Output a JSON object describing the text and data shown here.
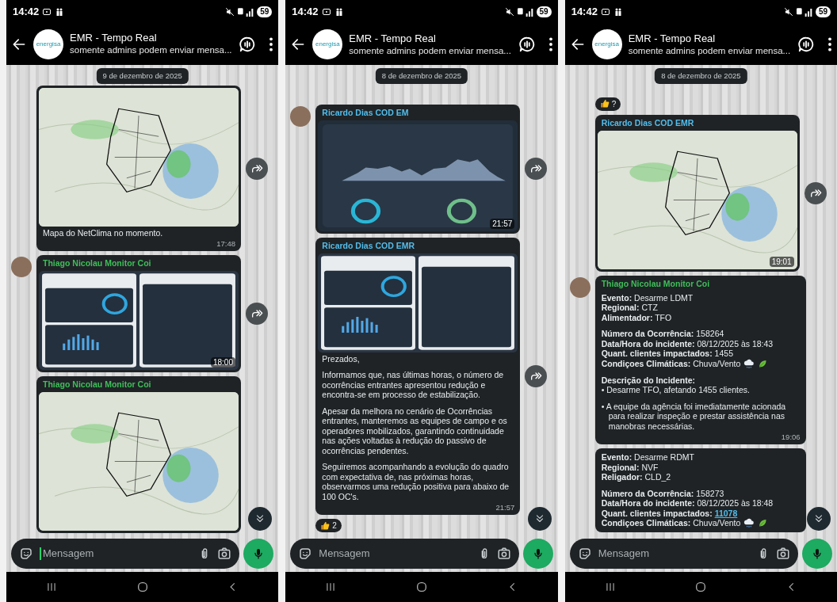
{
  "screens": [
    {
      "status_bar": {
        "time": "14:42",
        "battery": "59"
      },
      "header": {
        "logo_text": "energisa",
        "title": "EMR - Tempo Real",
        "subtitle": "somente admins podem enviar mensa..."
      },
      "date_chip": "9 de dezembro de 2025",
      "messages": [
        {
          "kind": "message",
          "avatar": false,
          "image": {
            "kind": "map"
          },
          "caption": "Mapa do NetClima no momento.",
          "time": "17:48",
          "forwardable": true
        },
        {
          "kind": "message",
          "avatar": true,
          "sender": "Thiago Nicolau Monitor Coi",
          "color": "#3fbf5a",
          "image": {
            "kind": "dashboard"
          },
          "time": "18:00",
          "forwardable": true
        },
        {
          "kind": "message",
          "avatar": false,
          "sender": "Thiago Nicolau Monitor Coi",
          "color": "#3fbf5a",
          "image": {
            "kind": "map"
          },
          "forwardable": false
        }
      ],
      "input": {
        "placeholder": "Mensagem",
        "focused": true
      }
    },
    {
      "status_bar": {
        "time": "14:42",
        "battery": "59"
      },
      "header": {
        "logo_text": "energisa",
        "title": "EMR - Tempo Real",
        "subtitle": "somente admins podem enviar mensa..."
      },
      "date_chip": "8 de dezembro de 2025",
      "messages": [
        {
          "kind": "message",
          "avatar": true,
          "sender": "Ricardo Dias COD EM",
          "color": "#53bdeb",
          "image": {
            "kind": "chart"
          },
          "time": "21:57",
          "forwardable": true
        },
        {
          "kind": "message",
          "avatar": false,
          "sender": "Ricardo Dias COD EMR",
          "color": "#53bdeb",
          "image": {
            "kind": "dashboard"
          },
          "paragraphs": [
            {
              "kind": "text",
              "lines": [
                {
                  "text": "Prezados,"
                }
              ]
            },
            {
              "kind": "text",
              "lines": [
                {
                  "text": "Informamos que, nas últimas horas, o número de ocorrências entrantes apresentou redução e encontra-se em processo de estabilização."
                }
              ]
            },
            {
              "kind": "text",
              "lines": [
                {
                  "text": "Apesar da melhora no cenário de Ocorrências entrantes, manteremos as equipes de campo e os operadores mobilizados, garantindo continuidade nas ações voltadas à redução do passivo de ocorrências pendentes."
                }
              ]
            },
            {
              "kind": "text",
              "lines": [
                {
                  "text": "Seguiremos acompanhando a evolução do quadro com expectativa de, nas próximas horas, observarmos uma redução positiva para abaixo de 100 OC's."
                }
              ]
            }
          ],
          "time": "21:57",
          "forwardable": true
        },
        {
          "kind": "reaction",
          "count": "2"
        }
      ],
      "input": {
        "placeholder": "Mensagem",
        "focused": false
      }
    },
    {
      "status_bar": {
        "time": "14:42",
        "battery": "59"
      },
      "header": {
        "logo_text": "energisa",
        "title": "EMR - Tempo Real",
        "subtitle": "somente admins podem enviar mensa..."
      },
      "date_chip": "8 de dezembro de 2025",
      "messages": [
        {
          "kind": "reaction",
          "count": "?"
        },
        {
          "kind": "message",
          "avatar": false,
          "sender": "Ricardo Dias COD EMR",
          "color": "#53bdeb",
          "image": {
            "kind": "map"
          },
          "time": "19:01",
          "forwardable": true
        },
        {
          "kind": "message",
          "avatar": true,
          "sender": "Thiago Nicolau Monitor Coi",
          "color": "#3fbf5a",
          "paragraphs": [
            {
              "kind": "text",
              "lines": [
                {
                  "text": "**Evento:** Desarme LDMT"
                },
                {
                  "text": "**Regional:** CTZ"
                },
                {
                  "text": "**Alimentador:** TFO"
                }
              ]
            },
            {
              "kind": "text",
              "lines": [
                {
                  "text": "**Número da Ocorrência:** 158264"
                },
                {
                  "text": "**Data/Hora do incidente:** 08/12/2025 às 18:43"
                },
                {
                  "text": "**Quant. clientes impactados:** 1455"
                },
                {
                  "text": "**Condiçoes Climáticas:** Chuva/Vento",
                  "weather_icons": true
                }
              ]
            },
            {
              "kind": "heading",
              "lines": [
                {
                  "text": "Descrição do Incidente:"
                }
              ]
            },
            {
              "kind": "bullets",
              "lines": [
                {
                  "text": "• Desarme TFO, afetando 1455 clientes."
                }
              ]
            },
            {
              "kind": "bullets",
              "lines": [
                {
                  "text": "• A equipe da agência foi imediatamente acionada para realizar inspeção e prestar assistência nas manobras necessárias."
                }
              ]
            }
          ],
          "time": "19:06",
          "forwardable": false
        },
        {
          "kind": "message",
          "avatar": false,
          "paragraphs": [
            {
              "kind": "text",
              "lines": [
                {
                  "text": "**Evento:** Desarme RDMT"
                },
                {
                  "text": "**Regional:** NVF"
                },
                {
                  "text": "**Religador:** CLD_2"
                }
              ]
            },
            {
              "kind": "text",
              "lines": [
                {
                  "text": "**Número da Ocorrência:** 158273"
                },
                {
                  "text": "**Data/Hora do incidente:** 08/12/2025 às 18:48"
                },
                {
                  "text": "**Quant. clientes impactados:**",
                  "link": "11078"
                },
                {
                  "text": "**Condiçoes Climáticas:** Chuva/Vento",
                  "weather_icons": true
                }
              ]
            }
          ],
          "forwardable": false
        }
      ],
      "input": {
        "placeholder": "Mensagem",
        "focused": false
      }
    }
  ]
}
